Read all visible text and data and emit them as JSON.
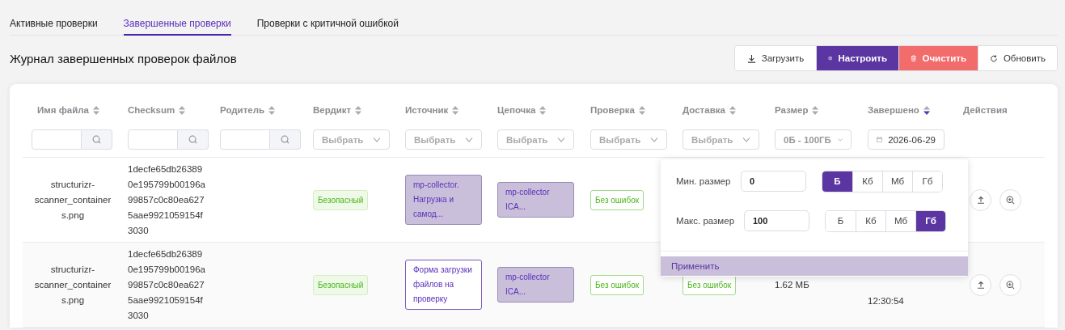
{
  "tabs": [
    {
      "label": "Активные проверки",
      "selected": false
    },
    {
      "label": "Завершенные проверки",
      "selected": true
    },
    {
      "label": "Проверки с критичной ошибкой",
      "selected": false
    }
  ],
  "title": "Журнал завершенных проверок файлов",
  "toolbar": [
    {
      "kind": "download",
      "label": "Загрузить"
    },
    {
      "kind": "configure",
      "label": "Настроить"
    },
    {
      "kind": "clear",
      "label": "Очистить"
    },
    {
      "kind": "refresh",
      "label": "Обновить"
    }
  ],
  "table": {
    "columns": [
      {
        "label": "Имя файла",
        "sorted": false,
        "filter": {
          "kind": "search"
        }
      },
      {
        "label": "Checksum",
        "sorted": false,
        "filter": {
          "kind": "search"
        }
      },
      {
        "label": "Родитель",
        "sorted": false,
        "filter": {
          "kind": "search"
        }
      },
      {
        "label": "Вердикт",
        "sorted": false,
        "filter": {
          "kind": "select",
          "placeholder": "Выбрать"
        }
      },
      {
        "label": "Источник",
        "sorted": false,
        "filter": {
          "kind": "select",
          "placeholder": "Выбрать"
        }
      },
      {
        "label": "Цепочка",
        "sorted": false,
        "filter": {
          "kind": "select",
          "placeholder": "Выбрать"
        }
      },
      {
        "label": "Проверка",
        "sorted": false,
        "filter": {
          "kind": "select",
          "placeholder": "Выбрать"
        }
      },
      {
        "label": "Доставка",
        "sorted": false,
        "filter": {
          "kind": "select",
          "placeholder": "Выбрать"
        }
      },
      {
        "label": "Размер",
        "sorted": false,
        "filter": {
          "kind": "range",
          "value": "0Б - 100ГБ"
        }
      },
      {
        "label": "Завершено",
        "sorted": true,
        "filter": {
          "kind": "date",
          "value": "2026-06-29"
        }
      },
      {
        "label": "Действия"
      }
    ],
    "rows": [
      {
        "file_name": "structurizr-scanner_containers.png",
        "checksum": "1decfe65db263890e195799b00196a99857c0c80ea6275aae9921059154f3030",
        "verdict": "Безопасный",
        "source": {
          "text": "mp-collector. Нагрузка и самод...",
          "highlighted": true
        },
        "chain": "mp-collector ICA...",
        "check": "Без ошибок"
      },
      {
        "file_name": "structurizr-scanner_containers.png",
        "checksum": "1decfe65db263890e195799b00196a99857c0c80ea6275aae9921059154f3030",
        "verdict": "Безопасный",
        "source": {
          "text": "Форма загрузки файлов на проверку",
          "highlighted": false
        },
        "chain": "mp-collector ICA...",
        "check": "Без ошибок",
        "delivery": "Без ошибок",
        "size": "1.62 МБ",
        "completed": "12:30:54"
      }
    ]
  },
  "size_popover": {
    "rows": [
      {
        "label": "Мин. размер",
        "value": "0",
        "units": [
          {
            "label": "Б",
            "selected": true
          },
          {
            "label": "Кб",
            "selected": false
          },
          {
            "label": "Мб",
            "selected": false
          },
          {
            "label": "Гб",
            "selected": false
          }
        ]
      },
      {
        "label": "Макс. размер",
        "value": "100",
        "units": [
          {
            "label": "Б",
            "selected": false
          },
          {
            "label": "Кб",
            "selected": false
          },
          {
            "label": "Мб",
            "selected": false
          },
          {
            "label": "Гб",
            "selected": true
          }
        ]
      }
    ],
    "apply": "Применить"
  }
}
